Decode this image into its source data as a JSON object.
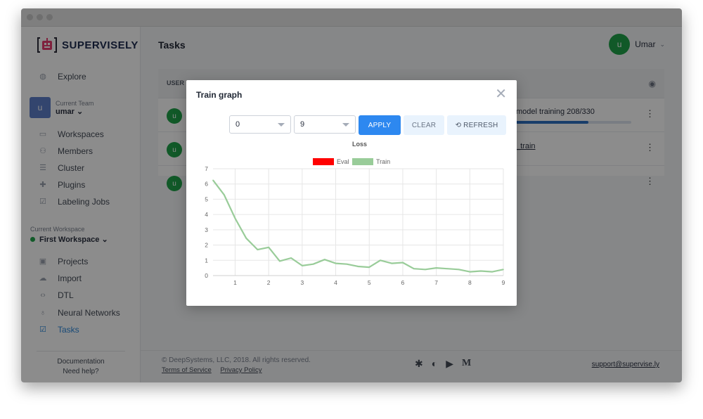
{
  "app": {
    "logo_text": "SUPERVISELY",
    "page_title": "Tasks",
    "user_name": "Umar",
    "user_initial": "u"
  },
  "sidebar": {
    "explore": "Explore",
    "team_label": "Current Team",
    "team_name": "umar ⌄",
    "team_initial": "u",
    "team_items": [
      "Workspaces",
      "Members",
      "Cluster",
      "Plugins",
      "Labeling Jobs"
    ],
    "workspace_label": "Current Workspace",
    "workspace_name": "First Workspace ⌄",
    "workspace_items": [
      "Projects",
      "Import",
      "DTL",
      "Neural Networks",
      "Tasks"
    ],
    "documentation": "Documentation",
    "need_help": "Need help?"
  },
  "table": {
    "header_user": "USER",
    "rows": [
      {
        "initial": "u",
        "status": "model training 208/330",
        "progress": 0.63
      },
      {
        "initial": "u",
        "link": "_train"
      },
      {
        "initial": "u"
      }
    ]
  },
  "footer": {
    "copyright": "© DeepSystems, LLC, 2018. All rights reserved.",
    "terms": "Terms of Service",
    "privacy": "Privacy Policy",
    "support": "support@supervise.ly"
  },
  "modal": {
    "title": "Train graph",
    "from_value": "0",
    "to_value": "9",
    "apply": "APPLY",
    "clear": "CLEAR",
    "refresh": "⟲ REFRESH"
  },
  "chart_data": {
    "type": "line",
    "title": "Loss",
    "legend_position": "top-center",
    "xlim": [
      0.34,
      9
    ],
    "ylim": [
      0,
      7
    ],
    "x_ticks": [
      1,
      2,
      3,
      4,
      5,
      6,
      7,
      8,
      9
    ],
    "y_ticks": [
      0,
      1,
      2,
      3,
      4,
      5,
      6,
      7
    ],
    "grid": true,
    "series": [
      {
        "name": "Eval",
        "color": "#ff0000",
        "x": [],
        "y": []
      },
      {
        "name": "Train",
        "color": "#99cc99",
        "x": [
          0.34,
          0.67,
          1.0,
          1.33,
          1.67,
          2.0,
          2.33,
          2.67,
          3.0,
          3.33,
          3.67,
          4.0,
          4.33,
          4.67,
          5.0,
          5.33,
          5.67,
          6.0,
          6.33,
          6.67,
          7.0,
          7.33,
          7.67,
          8.0,
          8.33,
          8.67,
          9.0
        ],
        "y": [
          6.25,
          5.3,
          3.75,
          2.45,
          1.7,
          1.85,
          0.95,
          1.15,
          0.65,
          0.75,
          1.05,
          0.8,
          0.75,
          0.6,
          0.55,
          1.0,
          0.8,
          0.85,
          0.45,
          0.4,
          0.5,
          0.45,
          0.4,
          0.25,
          0.3,
          0.25,
          0.4
        ]
      }
    ]
  }
}
